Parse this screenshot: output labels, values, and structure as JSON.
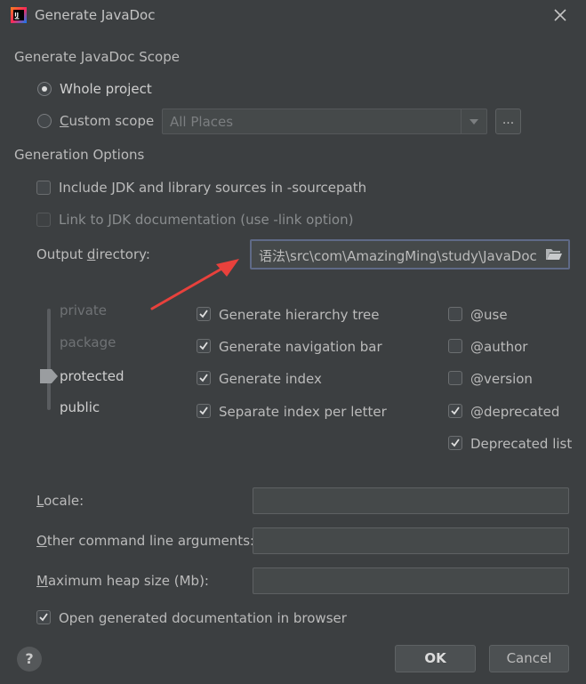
{
  "window": {
    "title": "Generate JavaDoc"
  },
  "scope": {
    "heading": "Generate JavaDoc Scope",
    "whole_project": "Whole project",
    "custom_scope_prefix": "C",
    "custom_scope_rest": "ustom scope",
    "custom_scope_combo": "All Places",
    "ellipsis": "...",
    "selected": "whole-project"
  },
  "options": {
    "heading": "Generation Options",
    "include_jdk": "Include JDK and library sources in -sourcepath",
    "link_jdk": "Link to JDK documentation (use -link option)",
    "output_label_pre": "Output ",
    "output_label_u": "d",
    "output_label_post": "irectory:",
    "output_value": "语法\\src\\com\\AmazingMing\\study\\JavaDoc"
  },
  "visibility": {
    "levels": [
      "private",
      "package",
      "protected",
      "public"
    ],
    "selected": "protected"
  },
  "checks_mid": [
    {
      "label": "Generate hierarchy tree",
      "checked": true
    },
    {
      "label": "Generate navigation bar",
      "checked": true
    },
    {
      "label": "Generate index",
      "checked": true
    },
    {
      "label": "Separate index per letter",
      "checked": true
    }
  ],
  "checks_right": [
    {
      "label": "@use",
      "checked": false
    },
    {
      "label": "@author",
      "checked": false
    },
    {
      "label": "@version",
      "checked": false
    },
    {
      "label": "@deprecated",
      "checked": true
    },
    {
      "label": "Deprecated list",
      "checked": true
    }
  ],
  "fields": {
    "locale_u": "L",
    "locale_rest": "ocale:",
    "other_u": "O",
    "other_rest": "ther command line arguments:",
    "heap_u": "M",
    "heap_rest": "aximum heap size (Mb):",
    "locale_value": "",
    "other_value": "",
    "heap_value": ""
  },
  "open_in_browser": {
    "label": "Open generated documentation in browser",
    "checked": true
  },
  "buttons": {
    "ok": "OK",
    "cancel": "Cancel",
    "help": "?"
  },
  "colors": {
    "background": "#3c3f41",
    "annotation_arrow": "#e8413c",
    "focus_border": "#5f6a87"
  }
}
